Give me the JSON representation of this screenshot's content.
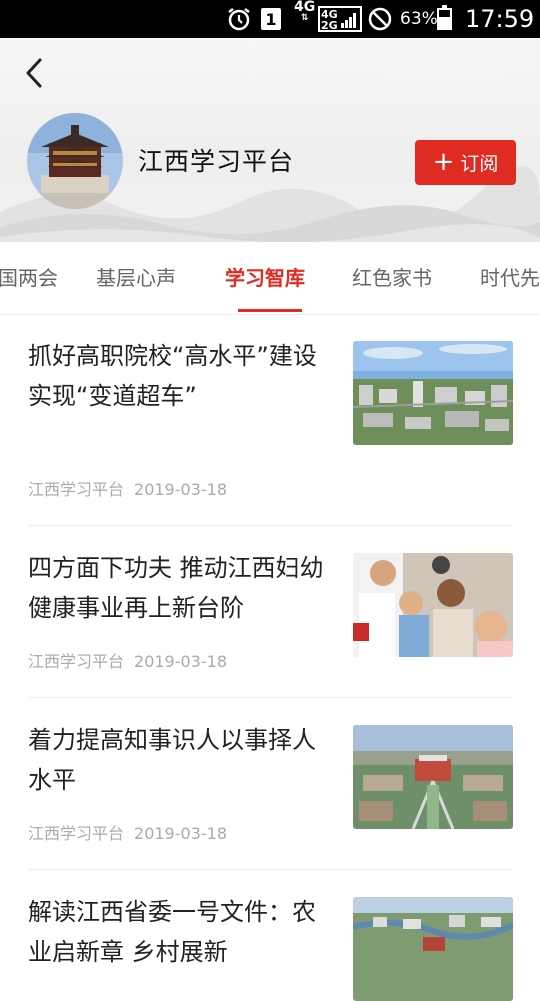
{
  "status_bar": {
    "network1": "4G",
    "network2_top": "4G",
    "network2_bottom": "2G",
    "sim_slot": "1",
    "battery": "63%",
    "battery_level": 0.63,
    "time": "17:59"
  },
  "header": {
    "channel_name": "江西学习平台",
    "subscribe_label": "订阅",
    "accent_color": "#e02b22"
  },
  "tabs": [
    {
      "label": "国两会"
    },
    {
      "label": "基层心声"
    },
    {
      "label": "学习智库",
      "active": true
    },
    {
      "label": "红色家书"
    },
    {
      "label": "时代先"
    }
  ],
  "articles": [
    {
      "title": "抓好高职院校“高水平”建设 实现“变道超车”",
      "source": "江西学习平台",
      "date": "2019-03-18"
    },
    {
      "title": "四方面下功夫 推动江西妇幼健康事业再上新台阶",
      "source": "江西学习平台",
      "date": "2019-03-18"
    },
    {
      "title": "着力提高知事识人以事择人水平",
      "source": "江西学习平台",
      "date": "2019-03-18"
    },
    {
      "title": "解读江西省委一号文件：农业启新章 乡村展新",
      "source": "",
      "date": ""
    }
  ]
}
